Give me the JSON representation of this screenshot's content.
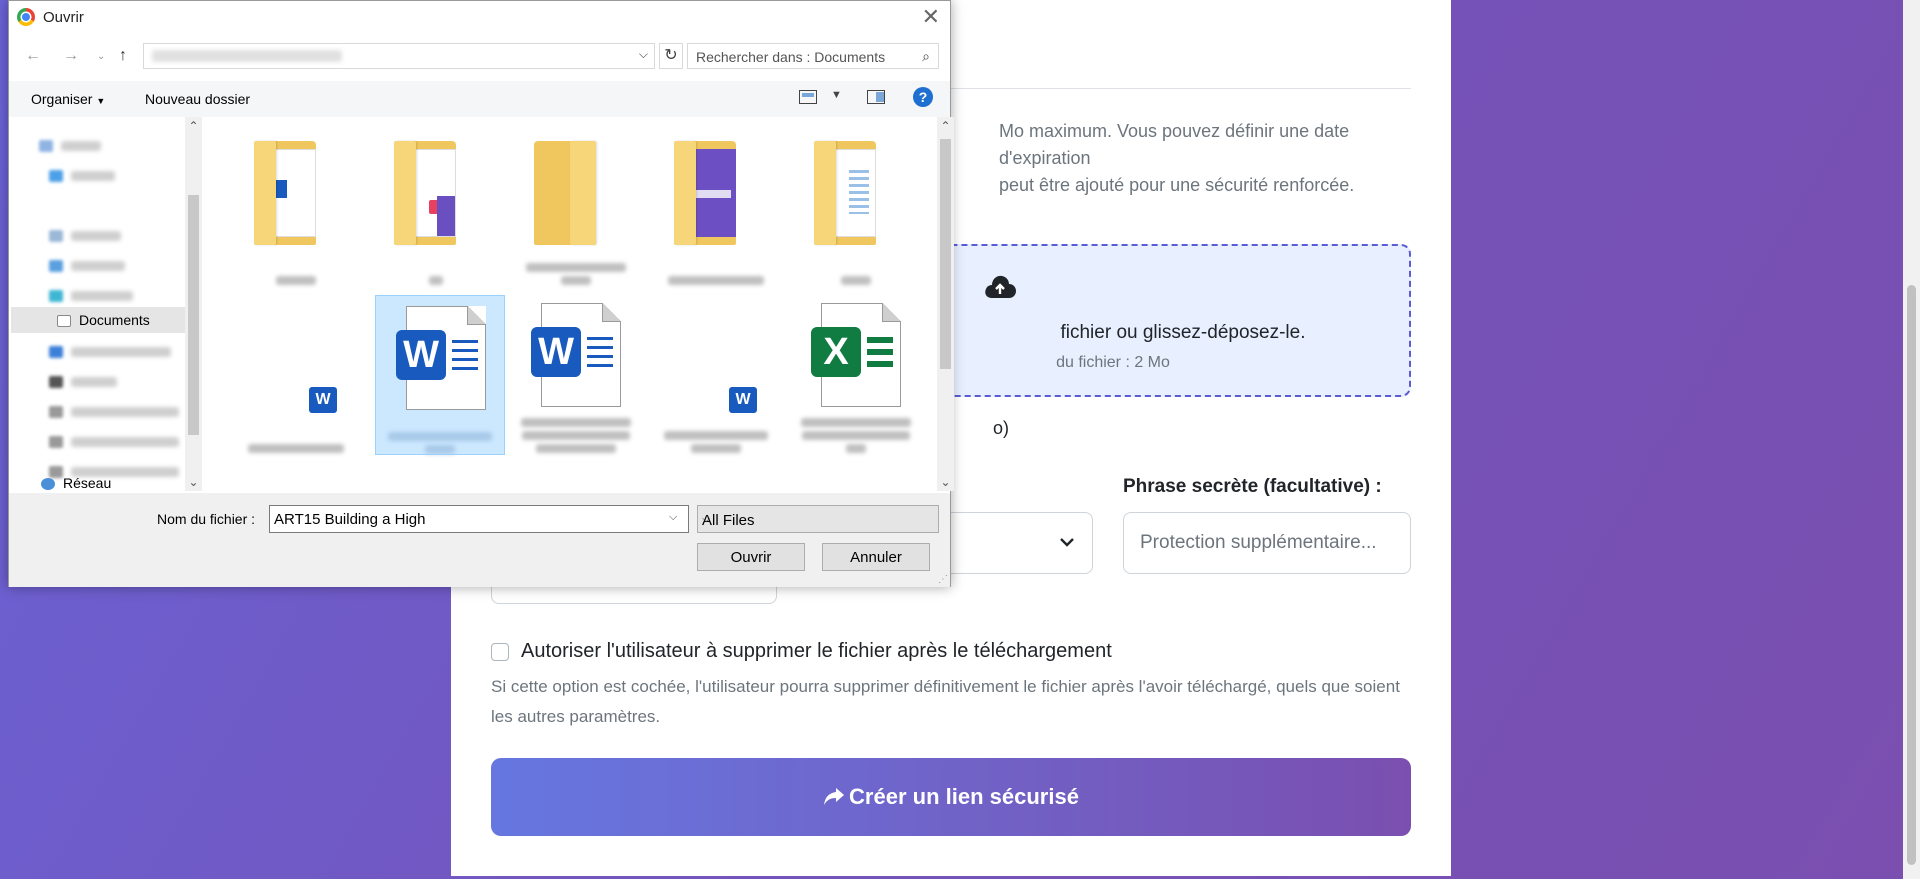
{
  "page": {
    "description_lines": [
      "Mo maximum. Vous pouvez définir une date d'expiration",
      "peut être ajouté pour une sécurité renforcée."
    ],
    "dropzone_main": "fichier ou glissez-déposez-le.",
    "dropzone_sub": "du fichier : 2 Mo",
    "size_note": "o)",
    "phrase_label": "Phrase secrète (facultative) :",
    "phrase_placeholder": "Protection supplémentaire...",
    "checkbox_label": "Autoriser l'utilisateur à supprimer le fichier après le téléchargement",
    "checkbox_help": "Si cette option est cochée, l'utilisateur pourra supprimer définitivement le fichier après l'avoir téléchargé, quels que soient les autres paramètres.",
    "create_button": "Créer un lien sécurisé",
    "colors": {
      "accent": "#5b5bd6",
      "button_start": "#6677e0",
      "button_end": "#7a4fb0"
    }
  },
  "dialog": {
    "title": "Ouvrir",
    "search_placeholder": "Rechercher dans : Documents",
    "organize": "Organiser",
    "new_folder": "Nouveau dossier",
    "help_label": "?",
    "nav_selected": "Documents",
    "nav_network": "Réseau",
    "file_name_label": "Nom du fichier :",
    "file_name_value": "ART15 Building a High",
    "file_type": "All Files",
    "open_button": "Ouvrir",
    "cancel_button": "Annuler",
    "file_tiles": [
      {
        "kind": "folder-docs"
      },
      {
        "kind": "folder-pages"
      },
      {
        "kind": "folder"
      },
      {
        "kind": "folder-purple"
      },
      {
        "kind": "folder-pages"
      },
      {
        "kind": "word-small"
      },
      {
        "kind": "word",
        "selected": true
      },
      {
        "kind": "word"
      },
      {
        "kind": "word-small"
      },
      {
        "kind": "excel"
      }
    ]
  }
}
